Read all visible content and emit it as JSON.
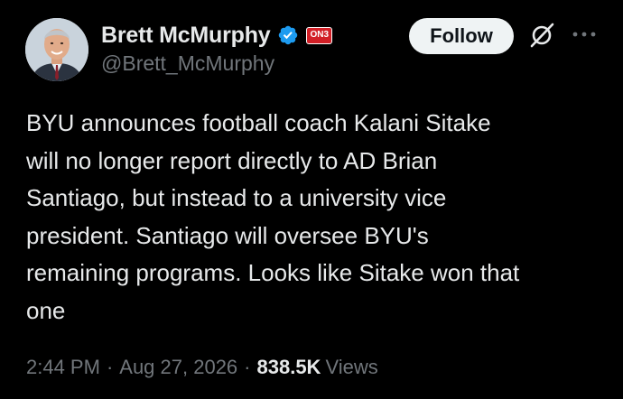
{
  "author": {
    "display_name": "Brett McMurphy",
    "handle": "@Brett_McMurphy",
    "verified": true,
    "affiliate_badge_text": "ON3",
    "avatar_icon": "avatar-photo"
  },
  "actions": {
    "follow_label": "Follow",
    "grok_icon": "grok-icon",
    "more_icon": "more-icon"
  },
  "tweet": {
    "text": "BYU announces football coach Kalani Sitake\nwill no longer report directly to AD Brian\nSantiago, but instead to a university vice\npresident. Santiago will oversee BYU's\nremaining programs. Looks like Sitake won that\none",
    "time": "2:44 PM",
    "separator": "·",
    "date": "Aug 27, 2026",
    "views_count": "838.5K",
    "views_label": "Views"
  },
  "colors": {
    "background": "#000000",
    "primary_text": "#e7e9ea",
    "secondary_text": "#71767b",
    "verified_blue": "#1d9bf0",
    "follow_bg": "#eff3f4",
    "badge_red": "#d21f26"
  }
}
